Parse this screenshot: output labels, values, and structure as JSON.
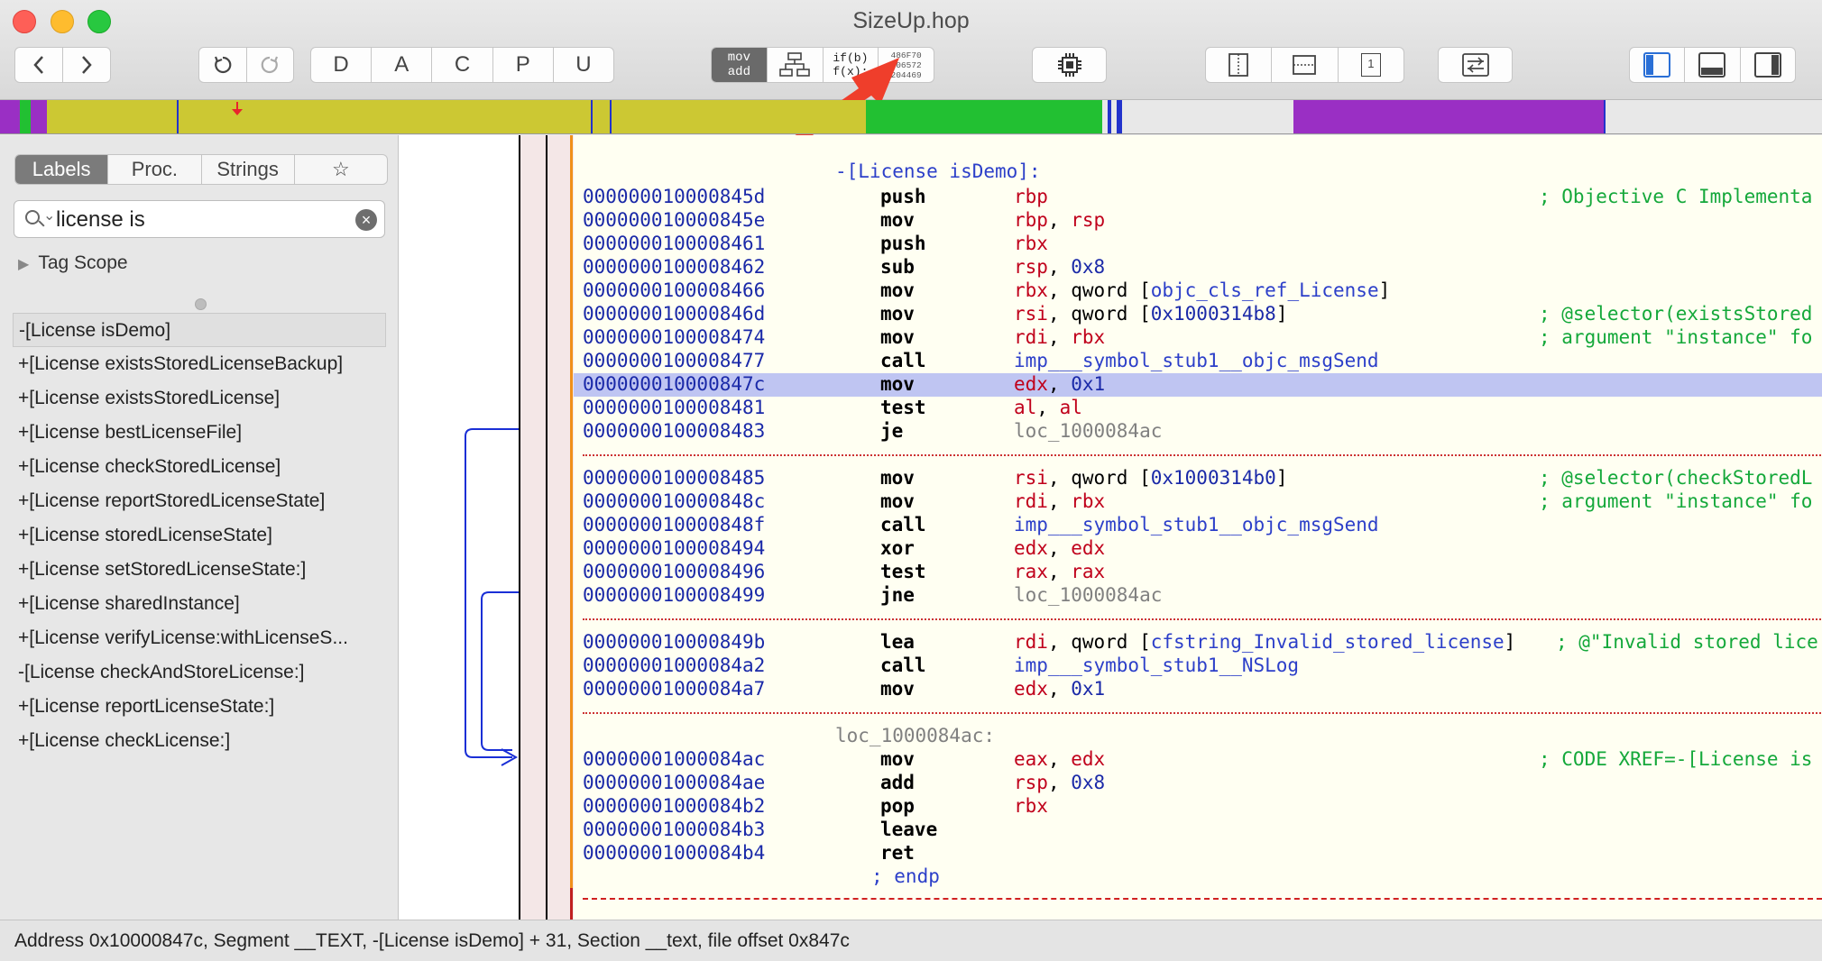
{
  "window": {
    "title": "SizeUp.hop"
  },
  "toolbar": {
    "seg_letters": [
      "D",
      "A",
      "C",
      "P",
      "U"
    ],
    "mode_asm_top": "mov",
    "mode_asm_bottom": "add",
    "mode_pseudo_top": "if(b)",
    "mode_pseudo_bottom": "f(x);",
    "mode_hex_lines": [
      "486F70",
      "706572",
      "204469"
    ],
    "segment_box_label": "1"
  },
  "nav_colors": {
    "yellow": "#ccc833",
    "green": "#22c032",
    "purple": "#9a2fc4",
    "gray": "#e8e8e8",
    "blue": "#2233cc",
    "marker": "#e8242c"
  },
  "sidebar": {
    "tabs": [
      "Labels",
      "Proc.",
      "Strings",
      "☆"
    ],
    "active_tab": "Labels",
    "search_value": "license is",
    "tag_scope": "Tag Scope",
    "labels": [
      "-[License isDemo]",
      "+[License existsStoredLicenseBackup]",
      "+[License existsStoredLicense]",
      "+[License bestLicenseFile]",
      "+[License checkStoredLicense]",
      "+[License reportStoredLicenseState]",
      "+[License storedLicenseState]",
      "+[License setStoredLicenseState:]",
      "+[License sharedInstance]",
      "+[License verifyLicense:withLicenseS...",
      "-[License checkAndStoreLicense:]",
      "+[License reportLicenseState:]",
      "+[License checkLicense:]"
    ]
  },
  "code": {
    "proc_header": "-[License isDemo]:",
    "lines": [
      {
        "addr": "000000010000845d",
        "mn": "push",
        "ops": [
          {
            "t": "rbp",
            "k": "reg"
          }
        ],
        "cmt": "; Objective C Implementa"
      },
      {
        "addr": "000000010000845e",
        "mn": "mov",
        "ops": [
          {
            "t": "rbp",
            "k": "reg"
          },
          {
            "t": ", ",
            "k": "blk"
          },
          {
            "t": "rsp",
            "k": "reg"
          }
        ],
        "cmt": ""
      },
      {
        "addr": "0000000100008461",
        "mn": "push",
        "ops": [
          {
            "t": "rbx",
            "k": "reg"
          }
        ],
        "cmt": ""
      },
      {
        "addr": "0000000100008462",
        "mn": "sub",
        "ops": [
          {
            "t": "rsp",
            "k": "reg"
          },
          {
            "t": ", ",
            "k": "blk"
          },
          {
            "t": "0x8",
            "k": "num"
          }
        ],
        "cmt": ""
      },
      {
        "addr": "0000000100008466",
        "mn": "mov",
        "ops": [
          {
            "t": "rbx",
            "k": "reg"
          },
          {
            "t": ", qword [",
            "k": "blk"
          },
          {
            "t": "objc_cls_ref_License",
            "k": "sym"
          },
          {
            "t": "]",
            "k": "blk"
          }
        ],
        "cmt": ""
      },
      {
        "addr": "000000010000846d",
        "mn": "mov",
        "ops": [
          {
            "t": "rsi",
            "k": "reg"
          },
          {
            "t": ", qword [",
            "k": "blk"
          },
          {
            "t": "0x1000314b8",
            "k": "num"
          },
          {
            "t": "]",
            "k": "blk"
          }
        ],
        "cmt": "; @selector(existsStored"
      },
      {
        "addr": "0000000100008474",
        "mn": "mov",
        "ops": [
          {
            "t": "rdi",
            "k": "reg"
          },
          {
            "t": ", ",
            "k": "blk"
          },
          {
            "t": "rbx",
            "k": "reg"
          }
        ],
        "cmt": "; argument \"instance\" fo"
      },
      {
        "addr": "0000000100008477",
        "mn": "call",
        "ops": [
          {
            "t": "imp___symbol_stub1__objc_msgSend",
            "k": "sym"
          }
        ],
        "cmt": ""
      },
      {
        "addr": "000000010000847c",
        "mn": "mov",
        "ops": [
          {
            "t": "edx",
            "k": "reg"
          },
          {
            "t": ", ",
            "k": "blk"
          },
          {
            "t": "0x1",
            "k": "num"
          }
        ],
        "cmt": "",
        "hl": true
      },
      {
        "addr": "0000000100008481",
        "mn": "test",
        "ops": [
          {
            "t": "al",
            "k": "reg"
          },
          {
            "t": ", ",
            "k": "blk"
          },
          {
            "t": "al",
            "k": "reg"
          }
        ],
        "cmt": ""
      },
      {
        "addr": "0000000100008483",
        "mn": "je",
        "ops": [
          {
            "t": "loc_1000084ac",
            "k": "loc"
          }
        ],
        "cmt": "",
        "sep": true
      },
      {
        "addr": "0000000100008485",
        "mn": "mov",
        "ops": [
          {
            "t": "rsi",
            "k": "reg"
          },
          {
            "t": ", qword [",
            "k": "blk"
          },
          {
            "t": "0x1000314b0",
            "k": "num"
          },
          {
            "t": "]",
            "k": "blk"
          }
        ],
        "cmt": "; @selector(checkStoredL"
      },
      {
        "addr": "000000010000848c",
        "mn": "mov",
        "ops": [
          {
            "t": "rdi",
            "k": "reg"
          },
          {
            "t": ", ",
            "k": "blk"
          },
          {
            "t": "rbx",
            "k": "reg"
          }
        ],
        "cmt": "; argument \"instance\" fo"
      },
      {
        "addr": "000000010000848f",
        "mn": "call",
        "ops": [
          {
            "t": "imp___symbol_stub1__objc_msgSend",
            "k": "sym"
          }
        ],
        "cmt": ""
      },
      {
        "addr": "0000000100008494",
        "mn": "xor",
        "ops": [
          {
            "t": "edx",
            "k": "reg"
          },
          {
            "t": ", ",
            "k": "blk"
          },
          {
            "t": "edx",
            "k": "reg"
          }
        ],
        "cmt": ""
      },
      {
        "addr": "0000000100008496",
        "mn": "test",
        "ops": [
          {
            "t": "rax",
            "k": "reg"
          },
          {
            "t": ", ",
            "k": "blk"
          },
          {
            "t": "rax",
            "k": "reg"
          }
        ],
        "cmt": ""
      },
      {
        "addr": "0000000100008499",
        "mn": "jne",
        "ops": [
          {
            "t": "loc_1000084ac",
            "k": "loc"
          }
        ],
        "cmt": "",
        "sep": true
      },
      {
        "addr": "000000010000849b",
        "mn": "lea",
        "ops": [
          {
            "t": "rdi",
            "k": "reg"
          },
          {
            "t": ", qword [",
            "k": "blk"
          },
          {
            "t": "cfstring_Invalid_stored_license",
            "k": "sym"
          },
          {
            "t": "]",
            "k": "blk"
          }
        ],
        "cmt": "; @\"Invalid stored lice",
        "cmtx": 1725
      },
      {
        "addr": "00000001000084a2",
        "mn": "call",
        "ops": [
          {
            "t": "imp___symbol_stub1__NSLog",
            "k": "sym"
          }
        ],
        "cmt": ""
      },
      {
        "addr": "00000001000084a7",
        "mn": "mov",
        "ops": [
          {
            "t": "edx",
            "k": "reg"
          },
          {
            "t": ", ",
            "k": "blk"
          },
          {
            "t": "0x1",
            "k": "num"
          }
        ],
        "cmt": "",
        "sep": true
      }
    ],
    "loc_label": "loc_1000084ac:",
    "lines2": [
      {
        "addr": "00000001000084ac",
        "mn": "mov",
        "ops": [
          {
            "t": "eax",
            "k": "reg"
          },
          {
            "t": ", ",
            "k": "blk"
          },
          {
            "t": "edx",
            "k": "reg"
          }
        ],
        "cmt": "; CODE XREF=-[License is"
      },
      {
        "addr": "00000001000084ae",
        "mn": "add",
        "ops": [
          {
            "t": "rsp",
            "k": "reg"
          },
          {
            "t": ", ",
            "k": "blk"
          },
          {
            "t": "0x8",
            "k": "num"
          }
        ],
        "cmt": ""
      },
      {
        "addr": "00000001000084b2",
        "mn": "pop",
        "ops": [
          {
            "t": "rbx",
            "k": "reg"
          }
        ],
        "cmt": ""
      },
      {
        "addr": "00000001000084b3",
        "mn": "leave",
        "ops": [],
        "cmt": ""
      },
      {
        "addr": "00000001000084b4",
        "mn": "ret",
        "ops": [],
        "cmt": ""
      }
    ],
    "endp": "; endp"
  },
  "status": {
    "text": "Address 0x10000847c, Segment __TEXT, -[License isDemo] + 31, Section __text, file offset 0x847c"
  }
}
